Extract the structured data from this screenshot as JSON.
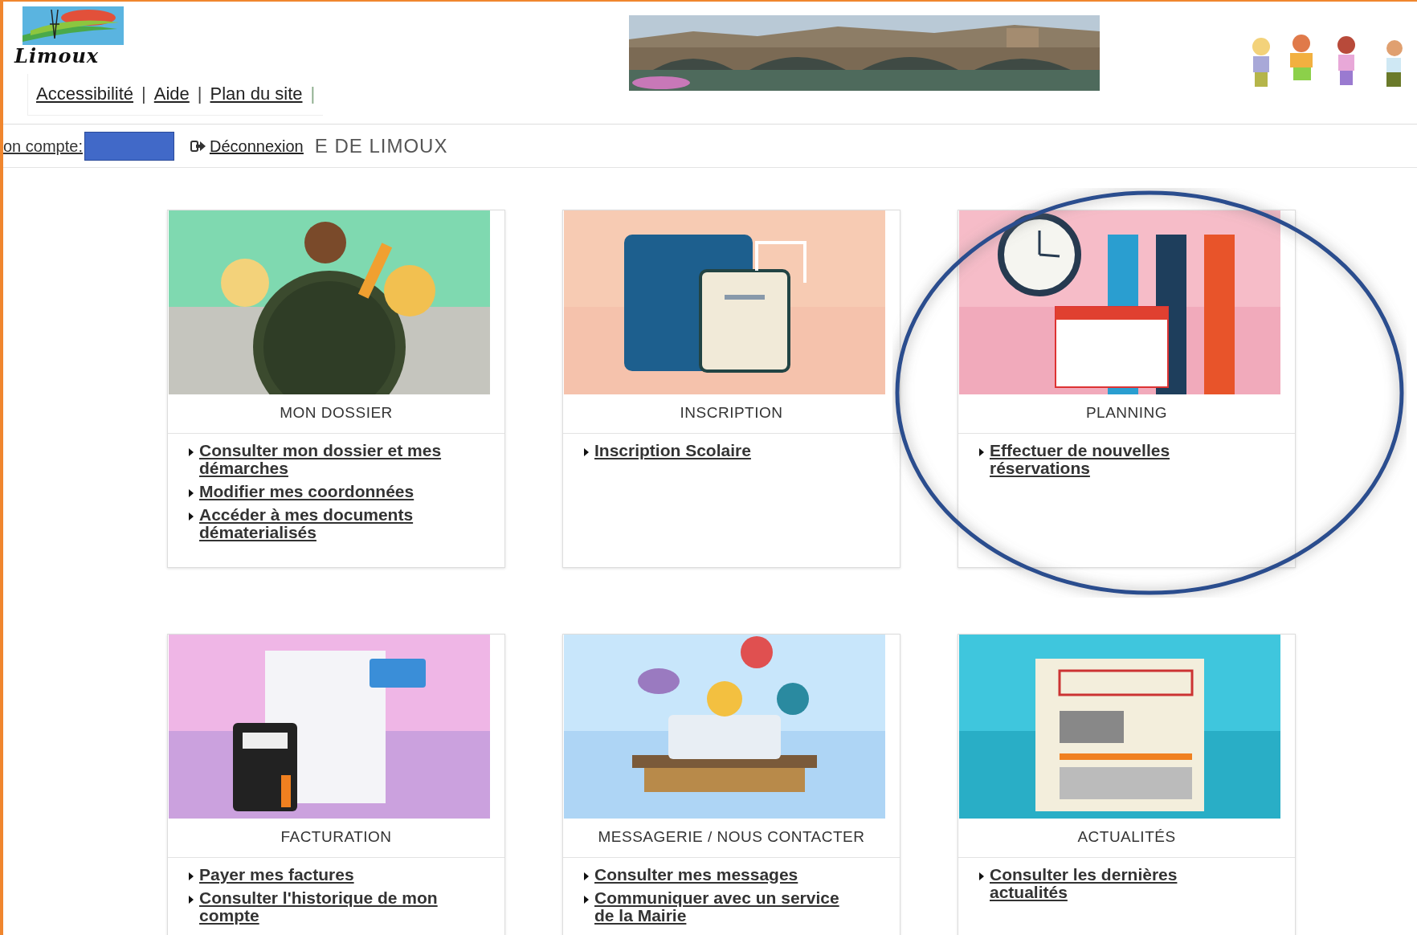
{
  "logo": {
    "text": "Limoux"
  },
  "header_links": [
    {
      "label": "Accessibilité",
      "separator": "|"
    },
    {
      "label": "Aide",
      "separator": "|"
    },
    {
      "label": "Plan du site",
      "separator": "|"
    }
  ],
  "account": {
    "label": "on compte:",
    "logout": "Déconnexion"
  },
  "portal_title": "E DE LIMOUX",
  "cards": [
    {
      "title": "MON DOSSIER",
      "links": [
        "Consulter mon dossier et mes démarches",
        "Modifier mes coordonnées",
        "Accéder à mes documents dématerialisés"
      ]
    },
    {
      "title": "INSCRIPTION",
      "links": [
        "Inscription Scolaire"
      ]
    },
    {
      "title": "PLANNING",
      "links": [
        "Effectuer de nouvelles réservations"
      ],
      "highlighted": true
    },
    {
      "title": "FACTURATION",
      "links": [
        "Payer mes factures",
        "Consulter l'historique de mon compte"
      ]
    },
    {
      "title": "MESSAGERIE / NOUS CONTACTER",
      "links": [
        "Consulter mes messages",
        "Communiquer avec un service de la Mairie"
      ]
    },
    {
      "title": "ACTUALITÉS",
      "links": [
        "Consulter les dernières actualités"
      ]
    }
  ]
}
